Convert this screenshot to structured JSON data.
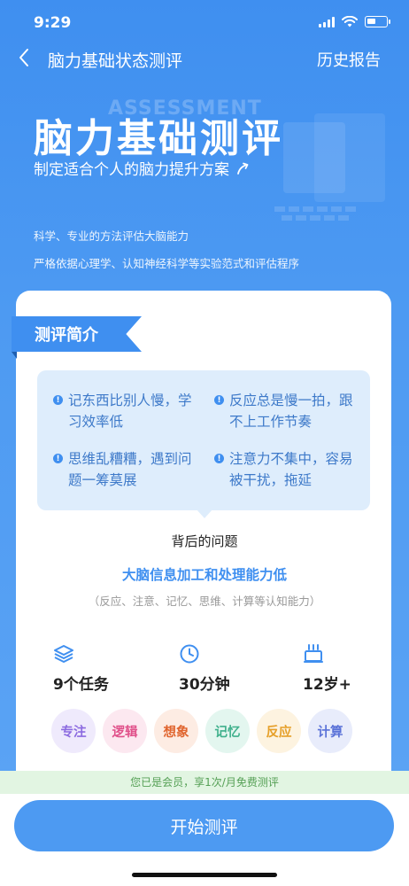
{
  "status": {
    "time": "9:29"
  },
  "nav": {
    "title": "脑力基础状态测评",
    "history": "历史报告"
  },
  "hero": {
    "watermark": "ASSESSMENT",
    "title": "脑力基础测评",
    "subtitle": "制定适合个人的脑力提升方案",
    "desc1": "科学、专业的方法评估大脑能力",
    "desc2": "严格依据心理学、认知神经科学等实验范式和评估程序"
  },
  "card": {
    "ribbon": "测评简介",
    "problems": [
      "记东西比别人慢，学习效率低",
      "反应总是慢一拍，跟不上工作节奏",
      "思维乱糟糟，遇到问题一筹莫展",
      "注意力不集中，容易被干扰，拖延"
    ],
    "behind": "背后的问题",
    "core": "大脑信息加工和处理能力低",
    "core_sub": "（反应、注意、记忆、思维、计算等认知能力）",
    "stats": [
      {
        "icon": "layers-icon",
        "value": "9个任务"
      },
      {
        "icon": "clock-icon",
        "value": "30分钟"
      },
      {
        "icon": "cake-icon",
        "value": "12岁+"
      }
    ],
    "tags": [
      {
        "label": "专注",
        "color": "#8c6be0",
        "bg": "#efeafc"
      },
      {
        "label": "逻辑",
        "color": "#e0508a",
        "bg": "#fce8f0"
      },
      {
        "label": "想象",
        "color": "#e0652f",
        "bg": "#fdece3"
      },
      {
        "label": "记忆",
        "color": "#3fb08c",
        "bg": "#e3f6ef"
      },
      {
        "label": "反应",
        "color": "#e6a02a",
        "bg": "#fdf3e0"
      },
      {
        "label": "计算",
        "color": "#5a72d8",
        "bg": "#e8ecfb"
      }
    ]
  },
  "member": "您已是会员，享1次/月免费测评",
  "start_button": "开始测评"
}
